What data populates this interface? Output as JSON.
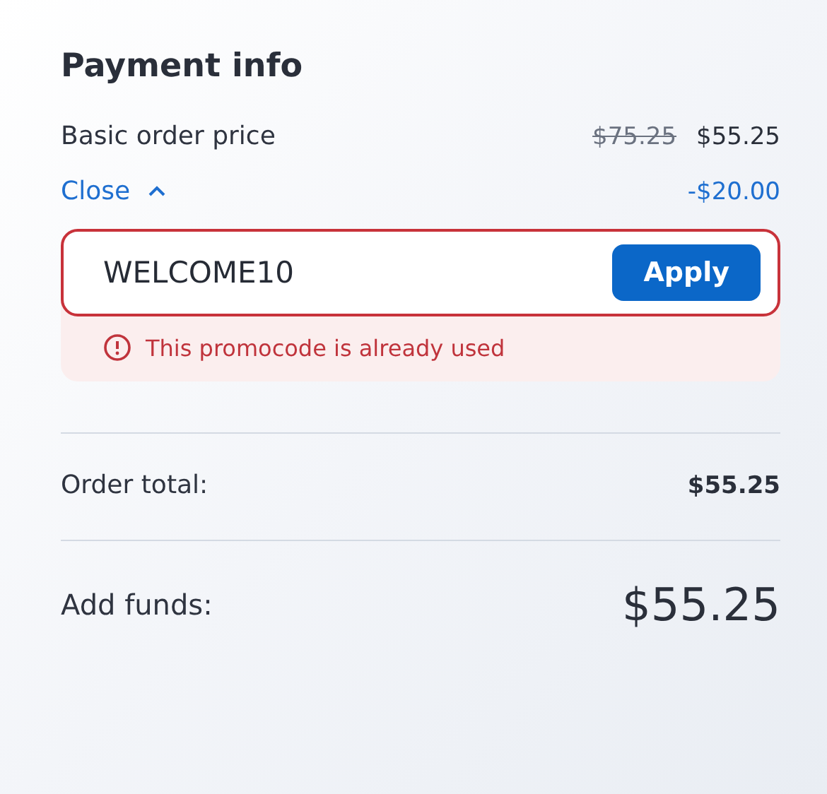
{
  "title": "Payment info",
  "basic_price": {
    "label": "Basic order price",
    "old_price": "$75.25",
    "price": "$55.25"
  },
  "promo": {
    "toggle_label": "Close",
    "expanded": true,
    "discount": "-$20.00",
    "code": "WELCOME10",
    "invalid": true,
    "button": "Apply",
    "error": "This promocode is already used"
  },
  "order_total": {
    "label": "Order total:",
    "value": "$55.25"
  },
  "add_funds": {
    "label": "Add funds:",
    "value": "$55.25"
  }
}
